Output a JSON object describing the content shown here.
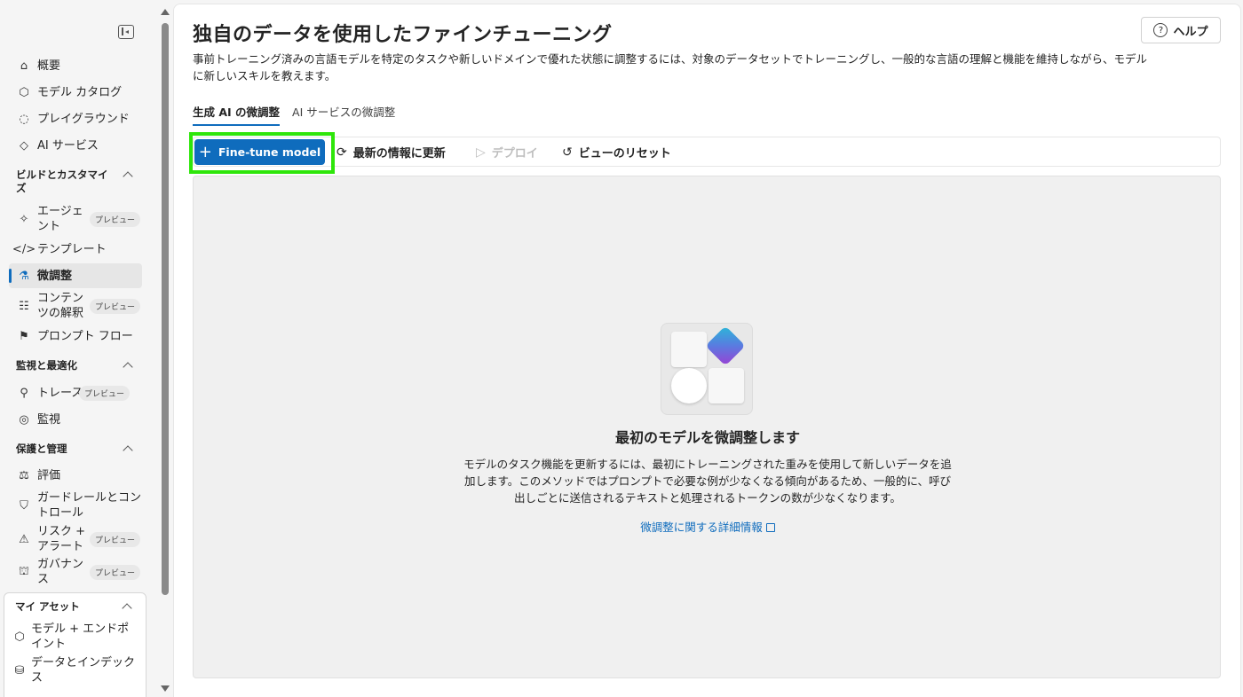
{
  "sidebar": {
    "top_items": [
      {
        "label": "概要",
        "icon": "overview-icon"
      },
      {
        "label": "モデル カタログ",
        "icon": "catalog-icon"
      },
      {
        "label": "プレイグラウンド",
        "icon": "playground-icon"
      },
      {
        "label": "AI サービス",
        "icon": "ai-services-icon"
      }
    ],
    "sections": {
      "build": {
        "title": "ビルドとカスタマイズ",
        "items": [
          {
            "label": "エージェント",
            "badge": "プレビュー"
          },
          {
            "label": "テンプレート"
          },
          {
            "label": "微調整"
          },
          {
            "label": "コンテンツの解釈",
            "badge": "プレビュー"
          },
          {
            "label": "プロンプト フロー"
          }
        ]
      },
      "monitor": {
        "title": "監視と最適化",
        "items": [
          {
            "label": "トレース",
            "badge": "プレビュー"
          },
          {
            "label": "監視"
          }
        ]
      },
      "protect": {
        "title": "保護と管理",
        "items": [
          {
            "label": "評価"
          },
          {
            "label": "ガードレールとコントロール"
          },
          {
            "label": "リスク + アラート",
            "badge": "プレビュー"
          },
          {
            "label": "ガバナンス",
            "badge": "プレビュー"
          }
        ]
      },
      "assets": {
        "title": "マイ アセット",
        "items": [
          {
            "label": "モデル + エンドポイント"
          },
          {
            "label": "データとインデックス"
          }
        ]
      }
    }
  },
  "main": {
    "title": "独自のデータを使用したファインチューニング",
    "help_label": "ヘルプ",
    "description": "事前トレーニング済みの言語モデルを特定のタスクや新しいドメインで優れた状態に調整するには、対象のデータセットでトレーニングし、一般的な言語の理解と機能を維持しながら、モデルに新しいスキルを教えます。",
    "tabs": [
      {
        "label": "生成 AI の微調整",
        "active": true
      },
      {
        "label": "AI サービスの微調整",
        "active": false
      }
    ],
    "toolbar": {
      "primary_label": "Fine-tune model",
      "refresh_label": "最新の情報に更新",
      "deploy_label": "デプロイ",
      "reset_label": "ビューのリセット"
    },
    "empty_state": {
      "title": "最初のモデルを微調整します",
      "description": "モデルのタスク機能を更新するには、最初にトレーニングされた重みを使用して新しいデータを追加します。このメソッドではプロンプトで必要な例が少なくなる傾向があるため、一般的に、呼び出しごとに送信されるテキストと処理されるトークンの数が少なくなります。",
      "link_label": "微調整に関する詳細情報"
    }
  },
  "colors": {
    "accent": "#0f6cbd",
    "highlight": "#2ee60a"
  }
}
